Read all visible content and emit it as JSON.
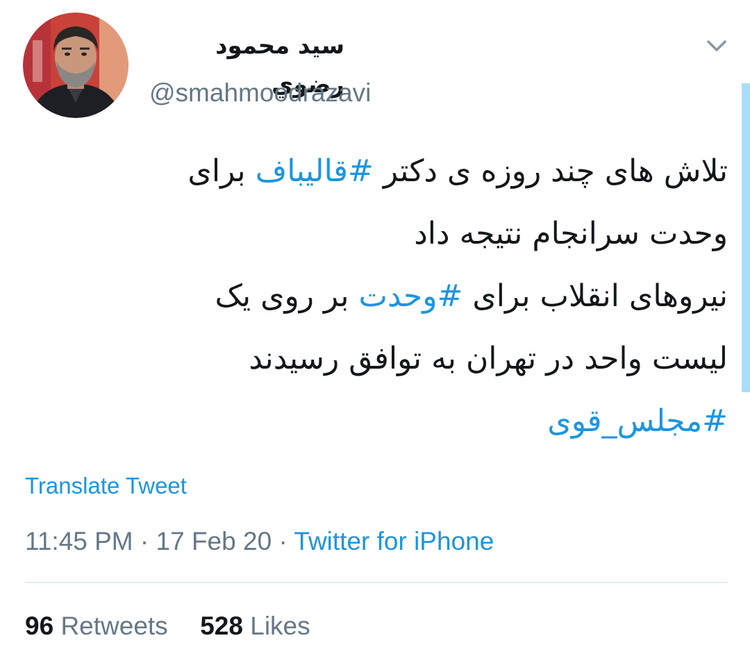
{
  "author": {
    "display_name": "سید محمود رضوي",
    "handle": "@smahmoodrazavi",
    "avatar_icon": "profile-photo-avatar"
  },
  "tweet": {
    "lines": [
      [
        {
          "text": "تلاش های چند روزه ی دکتر ",
          "hashtag": false
        },
        {
          "text": "#قالیباف",
          "hashtag": true
        },
        {
          "text": " برای",
          "hashtag": false
        }
      ],
      [
        {
          "text": "وحدت سرانجام نتیجه داد",
          "hashtag": false
        }
      ],
      [
        {
          "text": "نیروهای انقلاب برای ",
          "hashtag": false
        },
        {
          "text": "#وحدت",
          "hashtag": true
        },
        {
          "text": " بر روی یک",
          "hashtag": false
        }
      ],
      [
        {
          "text": "لیست واحد در تهران به توافق رسیدند",
          "hashtag": false
        }
      ],
      [
        {
          "text": "#مجلس_قوی",
          "hashtag": true
        }
      ]
    ]
  },
  "translate_label": "Translate Tweet",
  "meta": {
    "time": "11:45 PM",
    "separator": "·",
    "date": "17 Feb 20",
    "source": "Twitter for iPhone"
  },
  "stats": {
    "retweets_count": "96",
    "retweets_label": "Retweets",
    "likes_count": "528",
    "likes_label": "Likes"
  },
  "colors": {
    "link": "#1b95e0",
    "text": "#14171a",
    "secondary": "#657786",
    "divider": "#e6ecf0",
    "scrollbar": "#a9ddf9"
  },
  "icons": {
    "menu": "chevron-down-icon"
  }
}
